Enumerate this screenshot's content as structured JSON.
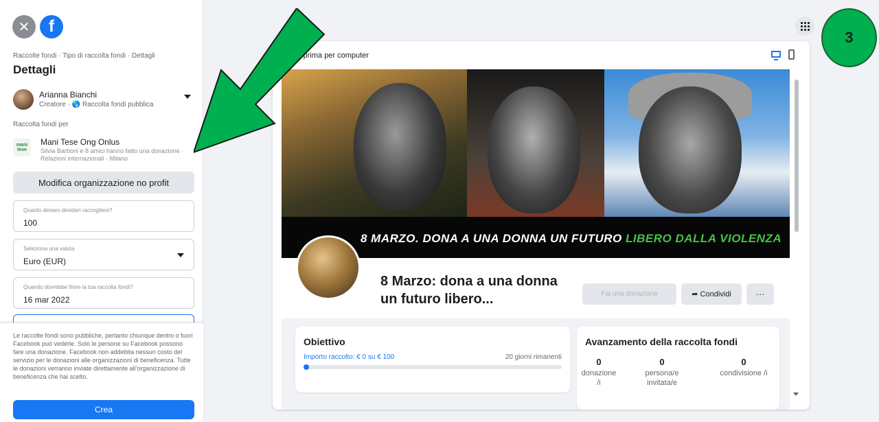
{
  "sidebar": {
    "breadcrumb": "Raccolte fondi · Tipo di raccolta fondi · Dettagli",
    "title": "Dettagli",
    "creator": {
      "name": "Arianna Bianchi",
      "subtitle": "Creatore · 🌎 Raccolta fondi pubblica"
    },
    "for_label": "Raccolta fondi per",
    "org": {
      "logo_text": "mani tese",
      "name": "Mani Tese Ong Onlus",
      "subtitle": "Silvia Barboni e 8 amici hanno fatto una donazione · Relazioni internazionali · Milano"
    },
    "edit_org_label": "Modifica organizzazione no profit",
    "fields": {
      "amount": {
        "label": "Quanto denaro desideri raccogliere?",
        "value": "100"
      },
      "currency": {
        "label": "Seleziona una valuta",
        "value": "Euro (EUR)"
      },
      "end_date": {
        "label": "Quando dovrebbe finire la tua raccolta fondi?",
        "value": "16 mar 2022"
      }
    },
    "disclaimer": "Le raccolte fondi sono pubbliche, pertanto chiunque dentro o fuori Facebook può vederle. Solo le persone su Facebook possono fare una donazione. Facebook non addebita nessun costo del servizio per le donazioni alle organizzazioni di beneficenza. Tutte le donazioni verranno inviate direttamente all'organizzazione di beneficenza che hai scelto.",
    "create_label": "Crea"
  },
  "step_badge": "3",
  "preview": {
    "label": "Anteprima per computer",
    "banner_white": "8 MARZO. DONA A UNA DONNA UN FUTURO",
    "banner_green": "LIBERO DALLA VIOLENZA",
    "campaign_title": "8 Marzo: dona a una donna un futuro libero...",
    "donate_label": "Fai una donazione",
    "share_label": "Condividi",
    "more_label": "···",
    "goal": {
      "heading": "Obiettivo",
      "raised": "Importo raccolto: € 0 su € 100",
      "days_left": "20 giorni rimanenti",
      "progress": 0
    },
    "progress": {
      "heading": "Avanzamento della raccolta fondi",
      "donations": {
        "value": "0",
        "label": "donazione /i"
      },
      "invited": {
        "value": "0",
        "label": "persona/e invitata/e"
      },
      "shares": {
        "value": "0",
        "label": "condivisione /i"
      }
    }
  },
  "colors": {
    "brand": "#1877f2",
    "annotation_arrow": "#00b050",
    "banner_green": "#44c244"
  },
  "icons": [
    "close-icon",
    "facebook-logo-icon",
    "globe-icon",
    "chevron-down-icon",
    "apps-grid-icon",
    "desktop-icon",
    "mobile-icon",
    "share-arrow-icon"
  ]
}
